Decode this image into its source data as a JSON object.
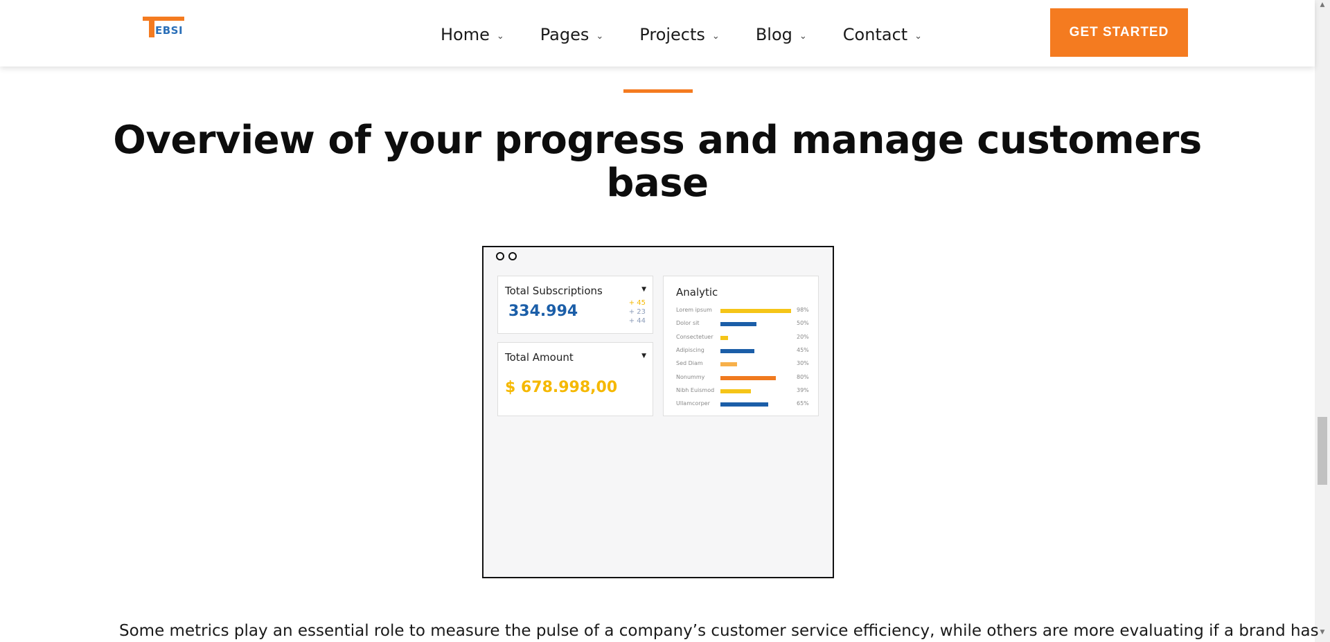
{
  "header": {
    "logo_text": "EBSI",
    "nav": [
      {
        "label": "Home"
      },
      {
        "label": "Pages"
      },
      {
        "label": "Projects"
      },
      {
        "label": "Blog"
      },
      {
        "label": "Contact"
      }
    ],
    "cta_label": "GET STARTED"
  },
  "section": {
    "title": "Overview of your progress and manage customers base",
    "paragraph": "Some metrics play an essential role to measure the pulse of a company’s customer service efficiency, while others are more evaluating if a brand has"
  },
  "dashboard": {
    "subscriptions": {
      "label": "Total Subscriptions",
      "value": "334.994",
      "deltas": [
        {
          "text": "+ 45",
          "color": "#f5b800"
        },
        {
          "text": "+ 23",
          "color": "#8a9bb8"
        },
        {
          "text": "+ 44",
          "color": "#8a9bb8"
        }
      ]
    },
    "amount": {
      "label": "Total Amount",
      "value": "$ 678.998,00"
    },
    "analytic": {
      "title": "Analytic",
      "rows": [
        {
          "label": "Lorem ipsum",
          "percent_text": "98%",
          "fraction": 0.98,
          "color": "#f5c518"
        },
        {
          "label": "Dolor sit",
          "percent_text": "50%",
          "fraction": 0.5,
          "color": "#1b5ea8"
        },
        {
          "label": "Consectetuer",
          "percent_text": "20%",
          "fraction": 0.11,
          "color": "#f5c518"
        },
        {
          "label": "Adipiscing",
          "percent_text": "45%",
          "fraction": 0.47,
          "color": "#1b5ea8"
        },
        {
          "label": "Sed Diam",
          "percent_text": "30%",
          "fraction": 0.23,
          "color": "#f7b04a"
        },
        {
          "label": "Nonummy",
          "percent_text": "80%",
          "fraction": 0.77,
          "color": "#f07a1f"
        },
        {
          "label": "Nibh Euismod",
          "percent_text": "39%",
          "fraction": 0.42,
          "color": "#f5c518"
        },
        {
          "label": "Ullamcorper",
          "percent_text": "65%",
          "fraction": 0.66,
          "color": "#1b5ea8"
        }
      ]
    }
  },
  "colors": {
    "accent": "#f47b20",
    "primary_blue": "#1b5ea8",
    "gold": "#f5b800"
  }
}
